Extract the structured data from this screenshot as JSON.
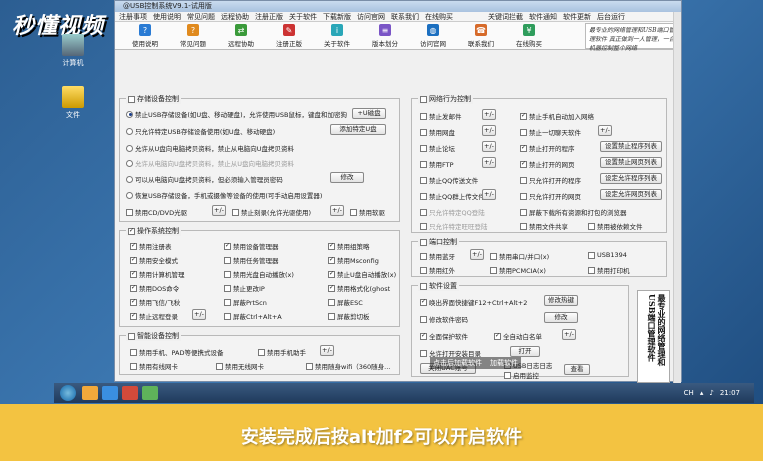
{
  "brand": {
    "text": "秒懂视频"
  },
  "desktop": {
    "icons": [
      {
        "label": "计算机"
      },
      {
        "label": "文件"
      }
    ]
  },
  "window": {
    "title": "@USB控制系统V9.1-试用版",
    "menu": [
      "注册事项",
      "使用说明",
      "常见问题",
      "远程协助",
      "注册正版",
      "关于软件",
      "下载新版",
      "访问官网",
      "联系我们",
      "在线购买"
    ],
    "menu_right": [
      "关键词拦截",
      "软件通知",
      "软件更新",
      "后台运行"
    ],
    "toolbar": [
      "使用说明",
      "常见问题",
      "远程协助",
      "注册正版",
      "关于软件",
      "版本划分",
      "访问官网",
      "联系我们",
      "在线购买"
    ],
    "banner": "最专业的网络管理和USB端口管理软件 真正做到一人管理，一台机器控制整个网络"
  },
  "storage": {
    "title": "存储设备控制",
    "options": [
      {
        "label": "禁止USB存储设备(如U盘、移动硬盘)，允许使用USB鼠标，键盘和加密狗",
        "selected": true
      },
      {
        "label": "只允许特定USB存储设备使用(如U盘、移动硬盘)",
        "selected": false
      },
      {
        "label": "允许从U盘向电脑拷贝资料，禁止从电脑向U盘拷贝资料",
        "selected": false
      },
      {
        "label": "允许从电脑向U盘拷贝资料，禁止从U盘向电脑拷贝资料",
        "selected": false,
        "disabled": true
      },
      {
        "label": "可以从电脑向U盘拷贝资料，但必须输入管理员密码",
        "selected": false
      },
      {
        "label": "恢复USB存储设备，手机或摄像等设备的使用(可手动启用设置器)",
        "selected": false
      }
    ],
    "checks": [
      {
        "label": "禁用CD/DVD光驱",
        "checked": false
      },
      {
        "label": "禁止刻录(允许光驱使用)",
        "checked": false
      },
      {
        "label": "禁用软驱",
        "checked": false
      }
    ],
    "buttons": {
      "encrypt": "+U磁盘",
      "add_usb": "添加特定U盘",
      "modify": "修改",
      "plusminus": "+/-"
    }
  },
  "ops": {
    "title": "操作系统控制",
    "items": [
      {
        "label": "禁用注册表",
        "checked": true
      },
      {
        "label": "禁用设备管理器",
        "checked": true
      },
      {
        "label": "禁用组策略",
        "checked": true
      },
      {
        "label": "禁用安全模式",
        "checked": true
      },
      {
        "label": "禁用任务管理器",
        "checked": false
      },
      {
        "label": "禁用Msconfig",
        "checked": true
      },
      {
        "label": "禁用计算机管理",
        "checked": true
      },
      {
        "label": "禁用光盘自动播放(x)",
        "checked": false
      },
      {
        "label": "禁止U盘自动播放(x)",
        "checked": true
      },
      {
        "label": "禁用DOS命令",
        "checked": true
      },
      {
        "label": "禁止更改IP",
        "checked": false
      },
      {
        "label": "禁用格式化(ghost",
        "checked": true
      },
      {
        "label": "禁用飞信/飞秋",
        "checked": true
      },
      {
        "label": "屏蔽PrtScn",
        "checked": false
      },
      {
        "label": "屏蔽ESC",
        "checked": false
      },
      {
        "label": "禁止远程登录",
        "checked": true
      },
      {
        "label": "屏蔽Ctrl+Alt+A",
        "checked": false
      },
      {
        "label": "屏蔽剪切板",
        "checked": false
      }
    ]
  },
  "mobile": {
    "title": "智能设备控制",
    "items": [
      {
        "label": "禁用手机、PAD等便携式设备",
        "checked": false
      },
      {
        "label": "禁用手机助手",
        "checked": false
      },
      {
        "label": "禁用有线网卡",
        "checked": false
      },
      {
        "label": "禁用无线网卡",
        "checked": false
      },
      {
        "label": "禁用随身wifi（360随身...",
        "checked": false
      }
    ]
  },
  "net": {
    "title": "网络行为控制",
    "left": [
      {
        "label": "禁止发邮件",
        "checked": false
      },
      {
        "label": "禁用网盘",
        "checked": false
      },
      {
        "label": "禁止论坛",
        "checked": false
      },
      {
        "label": "禁用FTP",
        "checked": false
      },
      {
        "label": "禁止QQ传送文件",
        "checked": false
      },
      {
        "label": "禁止QQ群上传文件",
        "checked": false
      },
      {
        "label": "只允许特定QQ登陆",
        "checked": false,
        "disabled": true
      },
      {
        "label": "只允许特定旺旺登陆",
        "checked": false,
        "disabled": true
      }
    ],
    "right": [
      {
        "label": "禁止手机自动加入网络",
        "checked": true
      },
      {
        "label": "禁止一切聊天软件",
        "checked": false
      },
      {
        "label": "禁止打开的程序",
        "checked": true
      },
      {
        "label": "禁止打开的网页",
        "checked": true
      },
      {
        "label": "只允许打开的程序",
        "checked": false
      },
      {
        "label": "只允许打开的网页",
        "checked": false
      },
      {
        "label": "屏蔽下载所有资源和打包的浏览器",
        "checked": false
      },
      {
        "label": "禁用文件共享",
        "checked": false
      }
    ],
    "right_extra": "禁用被依赖文件",
    "buttons": [
      "设置禁止程序列表",
      "设置禁止网页列表",
      "设定允许程序列表",
      "设定允许网页列表"
    ]
  },
  "port": {
    "title": "端口控制",
    "items": [
      {
        "label": "禁用蓝牙",
        "checked": false
      },
      {
        "label": "禁用串口/并口(x)",
        "checked": false
      },
      {
        "label": "USB1394",
        "checked": false
      },
      {
        "label": "禁用红外",
        "checked": false
      },
      {
        "label": "禁用PCMCIA(x)",
        "checked": false
      },
      {
        "label": "禁用打印机",
        "checked": false
      }
    ]
  },
  "soft": {
    "title": "软件设置",
    "items": [
      {
        "label": "唤出界面快捷键F12+Ctrl+Alt+2",
        "checked": true
      },
      {
        "label": "修改软件密码",
        "checked": false
      },
      {
        "label": "全面保护软件",
        "checked": true
      },
      {
        "label": "全自动白名单",
        "checked": true
      },
      {
        "label": "允许打开安装目录",
        "checked": false
      }
    ],
    "buttons": {
      "hotkey": "修改热键",
      "modify": "修改",
      "open": "打开",
      "uac": "关闭UAC账号",
      "query": "查看"
    },
    "extra": [
      "USB日志日志",
      "启用监控"
    ]
  },
  "calligraphy": "最专业的网络管理和USB端口管理软件",
  "hint": {
    "items": [
      "点击后加载软件",
      "加载软件"
    ]
  },
  "taskbar": {
    "lang": "CH",
    "time": "21:07"
  },
  "subtitle": "安装完成后按alt加f2可以开启软件"
}
